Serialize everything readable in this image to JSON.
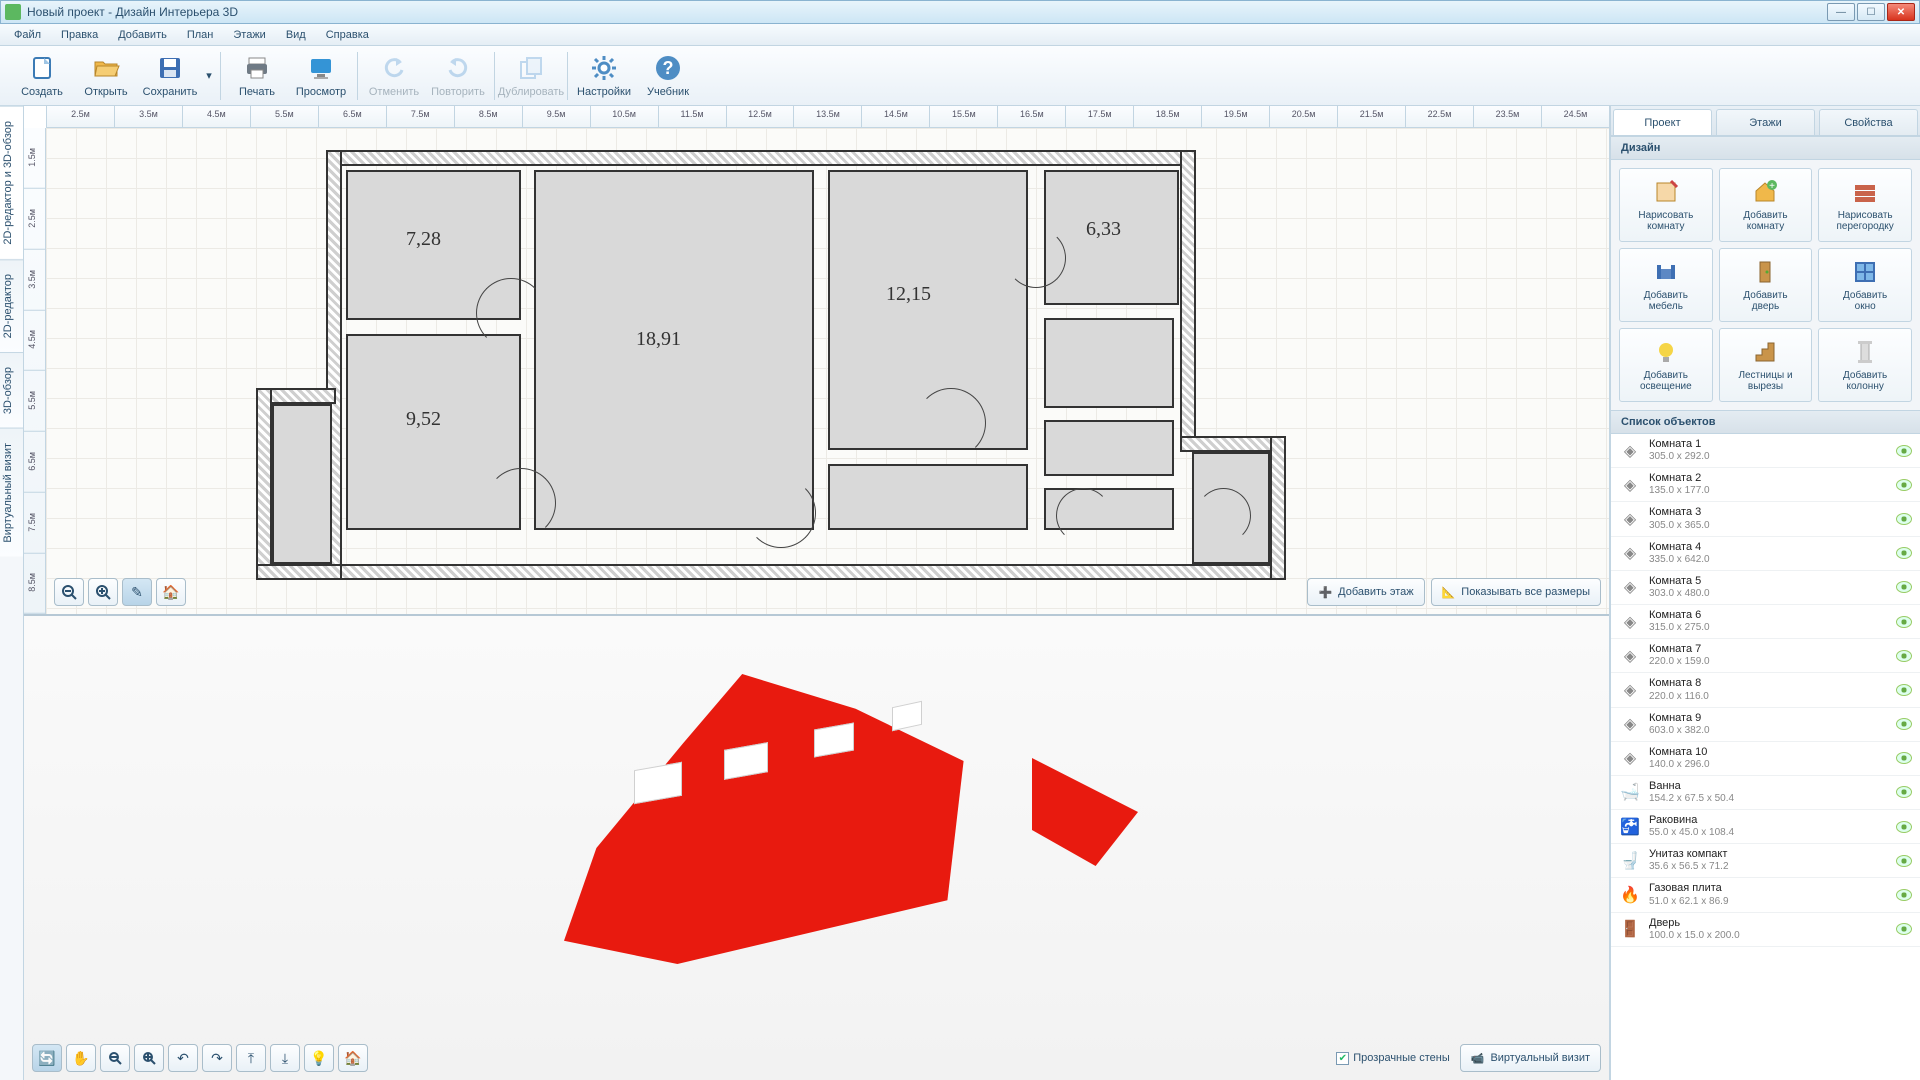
{
  "window": {
    "title": "Новый проект - Дизайн Интерьера 3D"
  },
  "menu": [
    "Файл",
    "Правка",
    "Добавить",
    "План",
    "Этажи",
    "Вид",
    "Справка"
  ],
  "toolbar": [
    {
      "id": "new",
      "label": "Создать",
      "icon": "new-icon",
      "enabled": true
    },
    {
      "id": "open",
      "label": "Открыть",
      "icon": "open-icon",
      "enabled": true
    },
    {
      "id": "save",
      "label": "Сохранить",
      "icon": "save-icon",
      "enabled": true,
      "dropdown": true
    },
    {
      "sep": true
    },
    {
      "id": "print",
      "label": "Печать",
      "icon": "print-icon",
      "enabled": true
    },
    {
      "id": "preview",
      "label": "Просмотр",
      "icon": "preview-icon",
      "enabled": true
    },
    {
      "sep": true
    },
    {
      "id": "undo",
      "label": "Отменить",
      "icon": "undo-icon",
      "enabled": false
    },
    {
      "id": "redo",
      "label": "Повторить",
      "icon": "redo-icon",
      "enabled": false
    },
    {
      "sep": true
    },
    {
      "id": "dup",
      "label": "Дублировать",
      "icon": "dup-icon",
      "enabled": false
    },
    {
      "sep": true
    },
    {
      "id": "settings",
      "label": "Настройки",
      "icon": "settings-icon",
      "enabled": true
    },
    {
      "id": "help",
      "label": "Учебник",
      "icon": "help-icon",
      "enabled": true
    }
  ],
  "side_tabs": [
    "2D-редактор и 3D-обзор",
    "2D-редактор",
    "3D-обзор",
    "Виртуальный визит"
  ],
  "side_active": 0,
  "rulers": {
    "h": [
      "2.5м",
      "3.5м",
      "4.5м",
      "5.5м",
      "6.5м",
      "7.5м",
      "8.5м",
      "9.5м",
      "10.5м",
      "11.5м",
      "12.5м",
      "13.5м",
      "14.5м",
      "15.5м",
      "16.5м",
      "17.5м",
      "18.5м",
      "19.5м",
      "20.5м",
      "21.5м",
      "22.5м",
      "23.5м",
      "24.5м"
    ],
    "v": [
      "1.5м",
      "2.5м",
      "3.5м",
      "4.5м",
      "5.5м",
      "6.5м",
      "7.5м",
      "8.5м"
    ]
  },
  "room_labels": [
    "7,28",
    "18,91",
    "12,15",
    "6,33",
    "9,52"
  ],
  "canvas_buttons": {
    "add_floor": "Добавить этаж",
    "show_dims": "Показывать все размеры"
  },
  "view3d": {
    "transparent_walls": "Прозрачные стены",
    "transparent_checked": true,
    "virtual_visit": "Виртуальный визит"
  },
  "right_tabs": [
    "Проект",
    "Этажи",
    "Свойства"
  ],
  "right_active": 0,
  "sections": {
    "design": "Дизайн",
    "objects": "Список объектов"
  },
  "design_btns": [
    {
      "label1": "Нарисовать",
      "label2": "комнату",
      "icon": "draw-room-icon"
    },
    {
      "label1": "Добавить",
      "label2": "комнату",
      "icon": "add-room-icon"
    },
    {
      "label1": "Нарисовать",
      "label2": "перегородку",
      "icon": "draw-wall-icon"
    },
    {
      "label1": "Добавить",
      "label2": "мебель",
      "icon": "furniture-icon"
    },
    {
      "label1": "Добавить",
      "label2": "дверь",
      "icon": "door-icon"
    },
    {
      "label1": "Добавить",
      "label2": "окно",
      "icon": "window-icon"
    },
    {
      "label1": "Добавить",
      "label2": "освещение",
      "icon": "light-icon"
    },
    {
      "label1": "Лестницы и",
      "label2": "вырезы",
      "icon": "stairs-icon"
    },
    {
      "label1": "Добавить",
      "label2": "колонну",
      "icon": "column-icon"
    }
  ],
  "objects": [
    {
      "name": "Комната 1",
      "dims": "305.0 x 292.0",
      "icon": "room"
    },
    {
      "name": "Комната 2",
      "dims": "135.0 x 177.0",
      "icon": "room"
    },
    {
      "name": "Комната 3",
      "dims": "305.0 x 365.0",
      "icon": "room"
    },
    {
      "name": "Комната 4",
      "dims": "335.0 x 642.0",
      "icon": "room"
    },
    {
      "name": "Комната 5",
      "dims": "303.0 x 480.0",
      "icon": "room"
    },
    {
      "name": "Комната 6",
      "dims": "315.0 x 275.0",
      "icon": "room"
    },
    {
      "name": "Комната 7",
      "dims": "220.0 x 159.0",
      "icon": "room"
    },
    {
      "name": "Комната 8",
      "dims": "220.0 x 116.0",
      "icon": "room"
    },
    {
      "name": "Комната 9",
      "dims": "603.0 x 382.0",
      "icon": "room"
    },
    {
      "name": "Комната 10",
      "dims": "140.0 x 296.0",
      "icon": "room"
    },
    {
      "name": "Ванна",
      "dims": "154.2 x 67.5 x 50.4",
      "icon": "bath"
    },
    {
      "name": "Раковина",
      "dims": "55.0 x 45.0 x 108.4",
      "icon": "sink"
    },
    {
      "name": "Унитаз компакт",
      "dims": "35.6 x 56.5 x 71.2",
      "icon": "toilet"
    },
    {
      "name": "Газовая плита",
      "dims": "51.0 x 62.1 x 86.9",
      "icon": "stove"
    },
    {
      "name": "Дверь",
      "dims": "100.0 x 15.0 x 200.0",
      "icon": "door"
    }
  ]
}
